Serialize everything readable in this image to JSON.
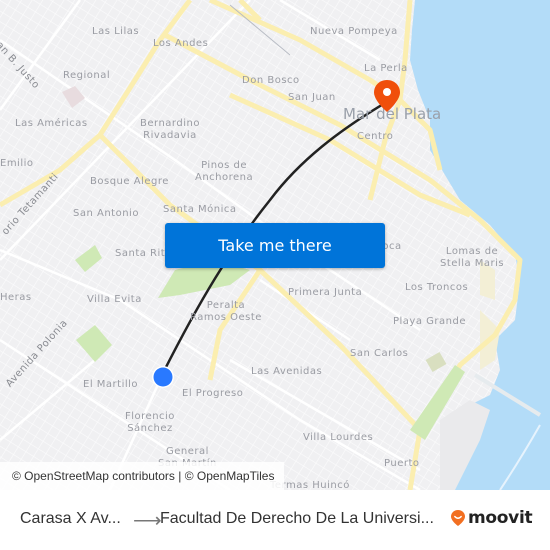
{
  "map": {
    "labels": {
      "las_lilas": "Las Lilas",
      "los_andes": "Los Andes",
      "nueva_pompeya": "Nueva Pompeya",
      "juan_b_justo": "an B. Justo",
      "regional": "Regional",
      "la_perla": "La Perla",
      "don_bosco": "Don Bosco",
      "san_juan": "San Juan",
      "mar_del_plata": "Mar del Plata",
      "las_americas": "Las Américas",
      "bernardino_rivadavia_1": "Bernardino",
      "bernardino_rivadavia_2": "Rivadavia",
      "centro": "Centro",
      "emilio": "Emilio",
      "pinos_1": "Pinos de",
      "pinos_2": "Anchorena",
      "bosque_alegre": "Bosque Alegre",
      "tetamanti": "orio Tetamanti",
      "san_antonio": "San Antonio",
      "santa_monica": "Santa Mónica",
      "santa_rita": "Santa Rita",
      "boca": "Boca",
      "lomas_1": "Lomas de",
      "lomas_2": "Stella Maris",
      "heras": "Heras",
      "villa_evita": "Villa Evita",
      "primera_junta": "Primera Junta",
      "los_troncos": "Los Troncos",
      "peralta_1": "Peralta",
      "peralta_2": "Ramos Oeste",
      "avenida_polonia": "Avenida Polonia",
      "playa_grande": "Playa Grande",
      "san_carlos": "San Carlos",
      "el_martillo": "El Martillo",
      "las_avenidas": "Las Avenidas",
      "el_progreso": "El Progreso",
      "florencio_1": "Florencio",
      "florencio_2": "Sánchez",
      "villa_lourdes": "Villa Lourdes",
      "general_1": "General",
      "general_2": "San Martín",
      "puerto": "Puerto",
      "termas": "Termas Huincó"
    },
    "destination_marker": "map-pin-icon",
    "origin_marker": "current-location-dot",
    "colors": {
      "water": "#b3dcf8",
      "major_road": "#fbeeb0",
      "park": "#cfe9b5",
      "route": "#222222",
      "pin": "#f04f0b",
      "origin": "#2979ff"
    }
  },
  "cta": {
    "label": "Take me there",
    "color": "#0074d9"
  },
  "attribution": "© OpenStreetMap contributors | © OpenMapTiles",
  "footer": {
    "from": "Carasa X Av...",
    "arrow": "⟶",
    "to": "Facultad De Derecho De La Universi...",
    "brand": "moovit",
    "brand_color": "#f26f21"
  }
}
